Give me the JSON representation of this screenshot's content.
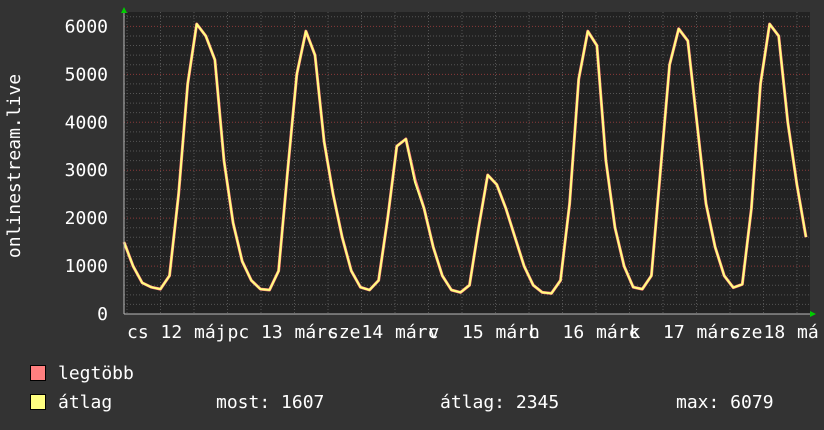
{
  "chart_data": {
    "type": "line",
    "ylabel": "onlinestream.live",
    "ylim": [
      0,
      6300
    ],
    "y_ticks": [
      "0",
      "1000",
      "2000",
      "3000",
      "4000",
      "5000",
      "6000"
    ],
    "x_tick_labels": [
      "cs",
      "12",
      "máj",
      "pc",
      "13",
      "márc",
      "sze",
      "14",
      "márc",
      "v",
      "15",
      "márc",
      "h",
      "16",
      "márc",
      "k",
      "17",
      "márc",
      "sze",
      "18",
      "má"
    ],
    "grid": true,
    "legend_position": "bottom-left",
    "series": [
      {
        "name": "legtöbb",
        "color": "#ff7f7f",
        "values": [
          1500,
          1000,
          650,
          560,
          520,
          800,
          2500,
          4800,
          6050,
          5800,
          5300,
          3200,
          1900,
          1100,
          700,
          520,
          500,
          900,
          3000,
          5000,
          5900,
          5400,
          3600,
          2500,
          1600,
          900,
          560,
          500,
          700,
          2000,
          3500,
          3650,
          2800,
          2200,
          1400,
          800,
          500,
          450,
          600,
          1800,
          2900,
          2700,
          2200,
          1600,
          1000,
          600,
          450,
          430,
          700,
          2300,
          4900,
          5900,
          5600,
          3200,
          1800,
          1000,
          560,
          520,
          800,
          3000,
          5200,
          5950,
          5700,
          4000,
          2300,
          1400,
          800,
          550,
          620,
          2200,
          4800,
          6050,
          5800,
          4000,
          2700,
          1600
        ]
      },
      {
        "name": "átlag",
        "color": "#ffff80",
        "values": [
          1500,
          1000,
          650,
          560,
          520,
          800,
          2500,
          4800,
          6050,
          5800,
          5300,
          3200,
          1900,
          1100,
          700,
          520,
          500,
          900,
          3000,
          5000,
          5900,
          5400,
          3600,
          2500,
          1600,
          900,
          560,
          500,
          700,
          2000,
          3500,
          3650,
          2750,
          2200,
          1400,
          800,
          500,
          450,
          600,
          1800,
          2900,
          2700,
          2200,
          1600,
          1000,
          600,
          450,
          430,
          700,
          2300,
          4900,
          5900,
          5600,
          3200,
          1800,
          1000,
          560,
          520,
          800,
          3000,
          5200,
          5950,
          5700,
          4000,
          2300,
          1400,
          800,
          550,
          620,
          2200,
          4800,
          6050,
          5800,
          4000,
          2700,
          1607
        ]
      }
    ]
  },
  "legend": {
    "max_label": "legtöbb",
    "avg_label": "átlag",
    "max_color": "#ff7f7f",
    "avg_color": "#ffff80"
  },
  "stats": {
    "now": "most: 1607",
    "avg": "átlag: 2345",
    "max": "max: 6079"
  }
}
